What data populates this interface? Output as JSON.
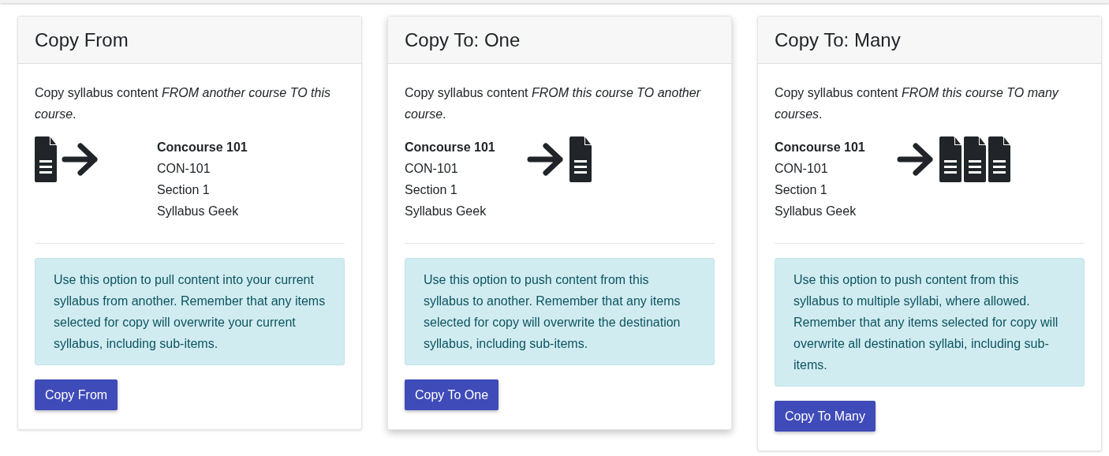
{
  "cards": [
    {
      "title": "Copy From",
      "kind": "from",
      "raised": false,
      "description": "Copy syllabus content *FROM another course TO this course*.",
      "course": {
        "name": "Concourse 101",
        "code": "CON-101",
        "section": "Section 1",
        "instructor": "Syllabus Geek"
      },
      "note": "Use this option to pull content into your current syllabus from another. Remember that any items selected for copy will overwrite your current syllabus, including sub-items.",
      "button": "Copy From"
    },
    {
      "title": "Copy To: One",
      "kind": "to_one",
      "raised": true,
      "description": "Copy syllabus content *FROM this course TO another course*.",
      "course": {
        "name": "Concourse 101",
        "code": "CON-101",
        "section": "Section 1",
        "instructor": "Syllabus Geek"
      },
      "note": "Use this option to push content from this syllabus to another. Remember that any items selected for copy will overwrite the destination syllabus, including sub-items.",
      "button": "Copy To One"
    },
    {
      "title": "Copy To: Many",
      "kind": "to_many",
      "raised": false,
      "description": "Copy syllabus content *FROM this course TO many courses*.",
      "course": {
        "name": "Concourse 101",
        "code": "CON-101",
        "section": "Section 1",
        "instructor": "Syllabus Geek"
      },
      "note": "Use this option to push content from this syllabus to multiple syllabi, where allowed. Remember that any items selected for copy will overwrite all destination syllabi, including sub-items.",
      "button": "Copy To Many"
    }
  ]
}
